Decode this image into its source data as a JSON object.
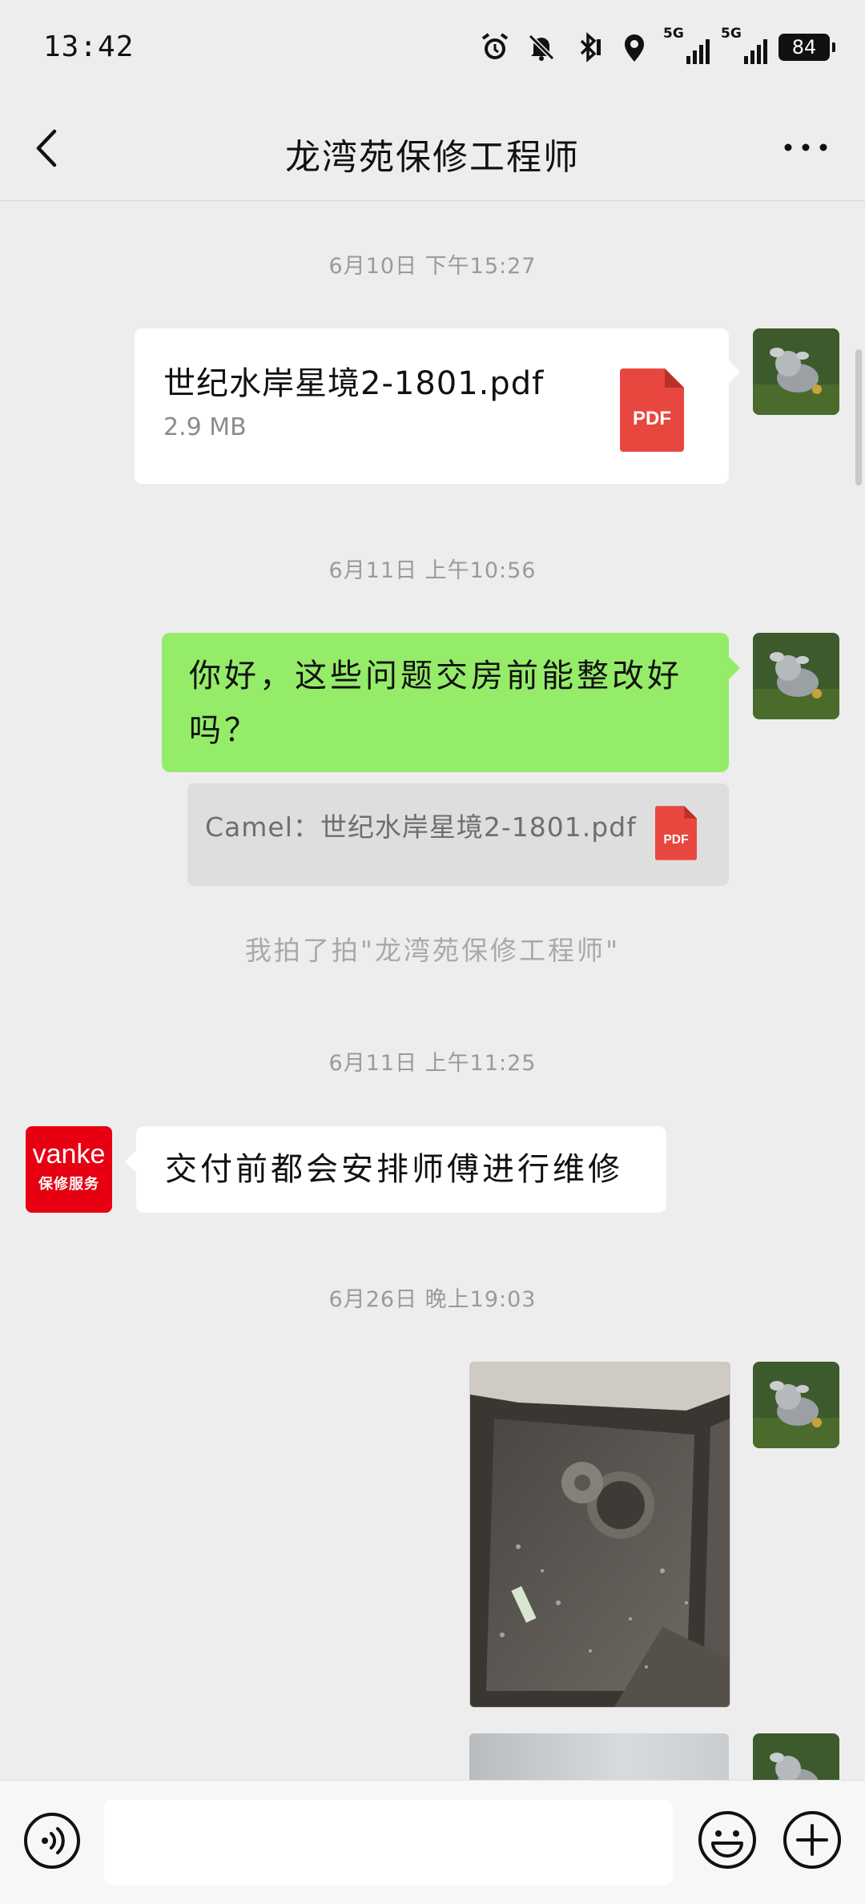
{
  "status_bar": {
    "time": "13:42",
    "network_label_1": "5G",
    "network_label_2": "5G",
    "battery": "84"
  },
  "header": {
    "title": "龙湾苑保修工程师"
  },
  "messages": [
    {
      "timestamp": "6月10日 下午15:27"
    },
    {
      "file_name": "世纪水岸星境2-1801.pdf",
      "file_size": "2.9 MB",
      "file_badge": "PDF"
    },
    {
      "timestamp": "6月11日 上午10:56"
    },
    {
      "text": "你好，这些问题交房前能整改好吗？",
      "line1": "你好，这些问题交房前能整改好",
      "line2": "吗？"
    },
    {
      "quote": "Camel：世纪水岸星境2-1801.pdf",
      "quote_badge": "PDF"
    },
    {
      "pat": "我拍了拍\"龙湾苑保修工程师\""
    },
    {
      "timestamp": "6月11日 上午11:25"
    },
    {
      "text": "交付前都会安排师傅进行维修",
      "avatar_brand": "vanke",
      "avatar_sub": "保修服务"
    },
    {
      "timestamp": "6月26日 晚上19:03"
    }
  ],
  "colors": {
    "background": "#ededed",
    "sent_bubble": "#95ec69",
    "received_bubble": "#ffffff",
    "pdf_red": "#e8473f",
    "vanke_red": "#e60012"
  },
  "icons": {
    "back": "chevron-left-icon",
    "more": "more-dots-icon",
    "voice": "voice-icon",
    "emoji": "emoji-icon",
    "plus": "plus-icon"
  }
}
